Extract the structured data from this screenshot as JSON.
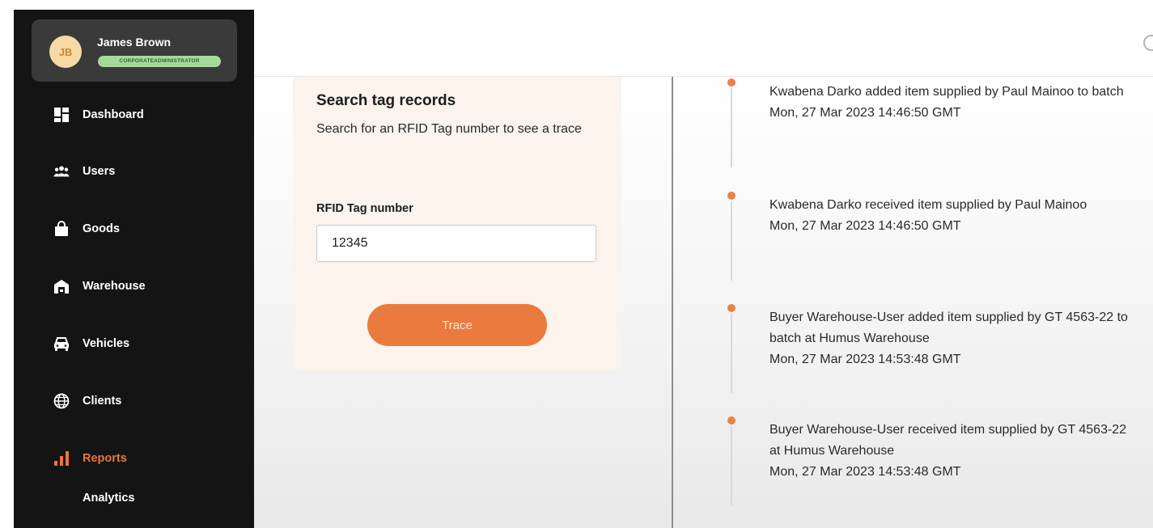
{
  "profile": {
    "initials": "JB",
    "name": "James Brown",
    "role": "CORPORATEADMINISTRATOR"
  },
  "nav": {
    "items": [
      {
        "label": "Dashboard",
        "icon": "dashboard-icon"
      },
      {
        "label": "Users",
        "icon": "users-icon"
      },
      {
        "label": "Goods",
        "icon": "shopping-bag-icon"
      },
      {
        "label": "Warehouse",
        "icon": "warehouse-icon"
      },
      {
        "label": "Vehicles",
        "icon": "car-icon"
      },
      {
        "label": "Clients",
        "icon": "globe-icon"
      },
      {
        "label": "Reports",
        "icon": "bar-chart-icon",
        "active": true
      }
    ],
    "sub_item": "Analytics"
  },
  "search": {
    "title": "Search tag records",
    "description": "Search for an RFID Tag number to see a trace",
    "field_label": "RFID Tag number",
    "field_value": "12345",
    "button_label": "Trace"
  },
  "timeline": [
    {
      "text": "Kwabena Darko added item supplied by Paul Mainoo to batch",
      "time": "Mon, 27 Mar 2023 14:46:50 GMT"
    },
    {
      "text": "Kwabena Darko received item supplied by Paul Mainoo",
      "time": "Mon, 27 Mar 2023 14:46:50 GMT"
    },
    {
      "text": "Buyer Warehouse-User added item supplied by GT 4563-22 to batch at Humus Warehouse",
      "time": "Mon, 27 Mar 2023 14:53:48 GMT"
    },
    {
      "text": "Buyer Warehouse-User received item supplied by GT 4563-22 at Humus Warehouse",
      "time": "Mon, 27 Mar 2023 14:53:48 GMT"
    }
  ],
  "colors": {
    "accent": "#ea7a3d",
    "sidebar": "#141414",
    "card": "#fbf3ec"
  }
}
